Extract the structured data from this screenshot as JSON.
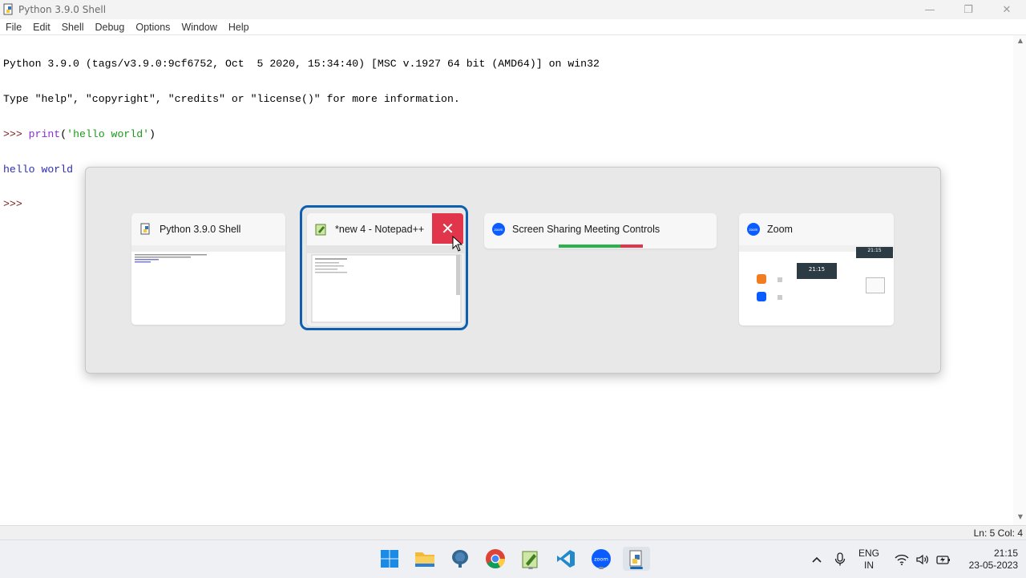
{
  "window": {
    "title": "Python 3.9.0 Shell",
    "minimize_label": "—",
    "maximize_label": "❐",
    "close_label": "✕"
  },
  "menu": {
    "items": [
      "File",
      "Edit",
      "Shell",
      "Debug",
      "Options",
      "Window",
      "Help"
    ]
  },
  "shell": {
    "line1": "Python 3.9.0 (tags/v3.9.0:9cf6752, Oct  5 2020, 15:34:40) [MSC v.1927 64 bit (AMD64)] on win32",
    "line2": "Type \"help\", \"copyright\", \"credits\" or \"license()\" for more information.",
    "line3_prompt": ">>> ",
    "line3_func": "print",
    "line3_open": "(",
    "line3_str": "'hello world'",
    "line3_close": ")",
    "line4_output": "hello world",
    "line5_prompt": ">>> "
  },
  "status": {
    "position": "Ln: 5  Col: 4"
  },
  "switcher": {
    "cards": [
      {
        "label": "Python 3.9.0 Shell",
        "icon": "python-idle-icon"
      },
      {
        "label": "*new 4 - Notepad++",
        "icon": "notepadpp-icon",
        "selected": true
      },
      {
        "label": "Screen Sharing Meeting Controls",
        "icon": "zoom-icon"
      },
      {
        "label": "Zoom",
        "icon": "zoom-icon"
      }
    ],
    "close_label": "✕",
    "zoom_thumb_time": "21:15"
  },
  "taskbar": {
    "apps": [
      "start-icon",
      "file-explorer-icon",
      "pgadmin-icon",
      "chrome-icon",
      "notepadpp-icon",
      "vscode-icon",
      "zoom-icon",
      "python-idle-icon"
    ],
    "zoom_label": "zoom",
    "lang_line1": "ENG",
    "lang_line2": "IN",
    "time": "21:15",
    "date": "23-05-2023",
    "tray_chevron": "^"
  },
  "colors": {
    "selection_ring": "#0f5fb0",
    "close_button": "#e0354a",
    "prompt": "#7a1a1a",
    "builtin": "#8a2be2",
    "string": "#1a9a1a",
    "output": "#2d2db5"
  }
}
